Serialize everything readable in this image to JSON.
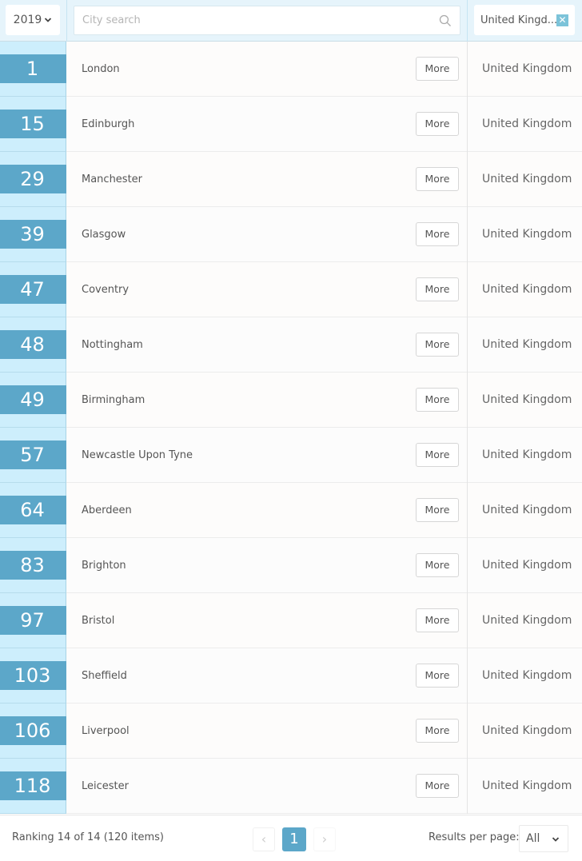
{
  "header": {
    "year_select": {
      "value": "2019"
    },
    "search": {
      "placeholder": "City search",
      "value": ""
    },
    "country_filter": {
      "value": "United Kingd...",
      "clear_label": "✕"
    }
  },
  "rows": [
    {
      "rank": "1",
      "city": "London",
      "more_label": "More",
      "country": "United Kingdom"
    },
    {
      "rank": "15",
      "city": "Edinburgh",
      "more_label": "More",
      "country": "United Kingdom"
    },
    {
      "rank": "29",
      "city": "Manchester",
      "more_label": "More",
      "country": "United Kingdom"
    },
    {
      "rank": "39",
      "city": "Glasgow",
      "more_label": "More",
      "country": "United Kingdom"
    },
    {
      "rank": "47",
      "city": "Coventry",
      "more_label": "More",
      "country": "United Kingdom"
    },
    {
      "rank": "48",
      "city": "Nottingham",
      "more_label": "More",
      "country": "United Kingdom"
    },
    {
      "rank": "49",
      "city": "Birmingham",
      "more_label": "More",
      "country": "United Kingdom"
    },
    {
      "rank": "57",
      "city": "Newcastle Upon Tyne",
      "more_label": "More",
      "country": "United Kingdom"
    },
    {
      "rank": "64",
      "city": "Aberdeen",
      "more_label": "More",
      "country": "United Kingdom"
    },
    {
      "rank": "83",
      "city": "Brighton",
      "more_label": "More",
      "country": "United Kingdom"
    },
    {
      "rank": "97",
      "city": "Bristol",
      "more_label": "More",
      "country": "United Kingdom"
    },
    {
      "rank": "103",
      "city": "Sheffield",
      "more_label": "More",
      "country": "United Kingdom"
    },
    {
      "rank": "106",
      "city": "Liverpool",
      "more_label": "More",
      "country": "United Kingdom"
    },
    {
      "rank": "118",
      "city": "Leicester",
      "more_label": "More",
      "country": "United Kingdom"
    }
  ],
  "footer": {
    "ranking_info": "Ranking 14 of 14 (120 items)",
    "pagination": {
      "prev": "‹",
      "current_page": "1",
      "next": "›"
    },
    "results_per_page_label": "Results per page:",
    "results_per_page_value": "All"
  },
  "colors": {
    "accent": "#5ca7c9",
    "rank_column_bg": "#cdeefc",
    "header_bg": "#e6f4fb",
    "clear_button": "#7cc3d9"
  }
}
